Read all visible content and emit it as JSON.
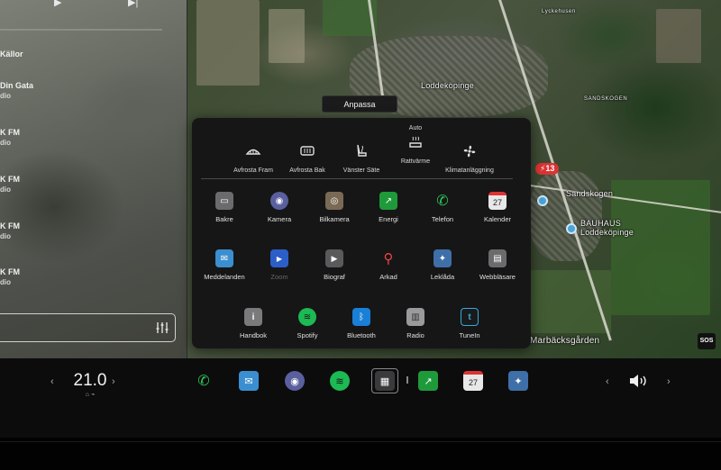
{
  "media": {
    "items": [
      {
        "title": "Källor",
        "sub": ""
      },
      {
        "title": "Din Gata",
        "sub": "dio"
      },
      {
        "title": "K FM",
        "sub": "dio"
      },
      {
        "title": "K FM",
        "sub": "dio"
      },
      {
        "title": "K FM",
        "sub": "dio"
      },
      {
        "title": "K FM",
        "sub": "dio"
      }
    ],
    "eq_icon": "equalizer-icon"
  },
  "map": {
    "labels": {
      "lyckehusen": "Lyckehusen",
      "loddekopinge": "Loddeköpinge",
      "sandskogen_area": "SANDSKOGEN",
      "sandskogen": "Sandskogen",
      "bauhaus_1": "BAUHAUS",
      "bauhaus_2": "Loddeköpinge",
      "marbacksgarden": "Marbäcksgården"
    },
    "route_sign": "13",
    "sos": "SOS"
  },
  "anpassa": "Anpassa",
  "quick_controls": [
    {
      "label": "Avfrosta Fram",
      "icon": "front-defrost-icon",
      "above": ""
    },
    {
      "label": "Avfrosta Bak",
      "icon": "rear-defrost-icon",
      "above": ""
    },
    {
      "label": "Vänster Säte",
      "icon": "seat-heater-icon",
      "above": ""
    },
    {
      "label": "Rattvärme",
      "icon": "steering-wheel-heater-icon",
      "above": "Auto"
    },
    {
      "label": "Klimatanläggning",
      "icon": "fan-icon",
      "above": ""
    }
  ],
  "apps": [
    {
      "label": "Bakre",
      "icon": "rear-display-icon",
      "color": "#6b6b6e",
      "glyph": "▭"
    },
    {
      "label": "Kamera",
      "icon": "camera-icon",
      "color": "#5a5f9e",
      "glyph": "◉"
    },
    {
      "label": "Bilkamera",
      "icon": "dashcam-icon",
      "color": "#7a6a55",
      "glyph": "◎"
    },
    {
      "label": "Energi",
      "icon": "energy-icon",
      "color": "#1f9a3a",
      "glyph": "↗"
    },
    {
      "label": "Telefon",
      "icon": "phone-icon",
      "color": "transparent",
      "glyph": "✆"
    },
    {
      "label": "Kalender",
      "icon": "calendar-icon",
      "color": "#e8e8e8",
      "glyph": "27"
    },
    {
      "label": "Meddelanden",
      "icon": "messages-icon",
      "color": "#3b8fd0",
      "glyph": "✉"
    },
    {
      "label": "Zoom",
      "icon": "zoom-icon",
      "color": "#2c5ec9",
      "glyph": "▶"
    },
    {
      "label": "Biograf",
      "icon": "theater-icon",
      "color": "#5a5a5c",
      "glyph": "▶"
    },
    {
      "label": "Arkad",
      "icon": "arcade-joystick-icon",
      "color": "transparent",
      "glyph": "⚲"
    },
    {
      "label": "Leklåda",
      "icon": "toybox-icon",
      "color": "#3f6fa8",
      "glyph": "✦"
    },
    {
      "label": "Webbläsare",
      "icon": "browser-icon",
      "color": "#6b6b6e",
      "glyph": "▤"
    },
    {
      "label": "Handbok",
      "icon": "manual-icon",
      "color": "#7a7a7c",
      "glyph": "i"
    },
    {
      "label": "Spotify",
      "icon": "spotify-icon",
      "color": "#1db954",
      "glyph": "≋"
    },
    {
      "label": "Bluetooth",
      "icon": "bluetooth-icon",
      "color": "#1a7fd6",
      "glyph": "ᛒ"
    },
    {
      "label": "Radio",
      "icon": "radio-icon",
      "color": "#9a9a9c",
      "glyph": "▥"
    },
    {
      "label": "TuneIn",
      "icon": "tunein-icon",
      "color": "#1a1a1a",
      "glyph": "t"
    }
  ],
  "dock": {
    "temperature": "21.0",
    "temp_arrow_left": "‹",
    "temp_arrow_right": "›",
    "vol_arrow_left": "‹",
    "vol_arrow_right": "›",
    "icons": [
      {
        "icon": "phone-icon",
        "glyph": "✆",
        "color": "transparent"
      },
      {
        "icon": "messages-icon",
        "glyph": "✉",
        "color": "#3b8fd0"
      },
      {
        "icon": "camera-icon",
        "glyph": "◉",
        "color": "#5a5f9e"
      },
      {
        "icon": "spotify-icon",
        "glyph": "≋",
        "color": "#1db954"
      },
      {
        "icon": "apps-launcher-icon",
        "glyph": "▦",
        "color": "#3a3a3c"
      },
      {
        "icon": "energy-icon",
        "glyph": "↗",
        "color": "#1f9a3a"
      },
      {
        "icon": "calendar-icon",
        "glyph": "27",
        "color": "#e8e8e8"
      },
      {
        "icon": "toybox-icon",
        "glyph": "✦",
        "color": "#3f6fa8"
      }
    ],
    "volume_icon": "volume-icon"
  }
}
